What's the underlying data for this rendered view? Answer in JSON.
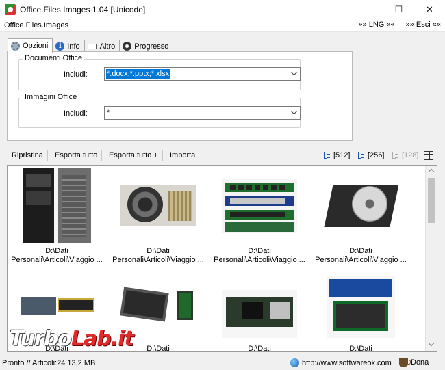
{
  "window": {
    "title": "Office.Files.Images 1.04 [Unicode]",
    "minimize": "–",
    "maximize": "☐",
    "close": "✕"
  },
  "menubar": {
    "app_name": "Office.Files.Images",
    "lng": "»» LNG ««",
    "exit": "»» Esci ««"
  },
  "tabs": [
    {
      "label": "Opzioni",
      "icon": "gear-icon",
      "active": true
    },
    {
      "label": "Info",
      "icon": "info-icon",
      "active": false
    },
    {
      "label": "Altro",
      "icon": "ruler-icon",
      "active": false
    },
    {
      "label": "Progresso",
      "icon": "progress-icon",
      "active": false
    }
  ],
  "options": {
    "office_docs": {
      "title": "Documenti Office",
      "include_label": "Includi:",
      "include_value": "*.docx;*.pptx;*.xlsx"
    },
    "office_images": {
      "title": "Immagini Office",
      "include_label": "Includi:",
      "include_value": "*"
    }
  },
  "toolbar": {
    "reset": "Ripristina",
    "export_all": "Esporta tutto",
    "export_all_plus": "Esporta tutto +",
    "import": "Importa",
    "size_512": "[512]",
    "size_256": "[256]",
    "size_128": "[128]"
  },
  "gallery": {
    "items": [
      {
        "line1": "D:\\Dati",
        "line2": "Personali\\Articoli\\Viaggio ..."
      },
      {
        "line1": "D:\\Dati",
        "line2": "Personali\\Articoli\\Viaggio ..."
      },
      {
        "line1": "D:\\Dati",
        "line2": "Personali\\Articoli\\Viaggio ..."
      },
      {
        "line1": "D:\\Dati",
        "line2": "Personali\\Articoli\\Viaggio ..."
      },
      {
        "line1": "D:\\Dati",
        "line2": ""
      },
      {
        "line1": "D:\\Dati",
        "line2": ""
      },
      {
        "line1": "D:\\Dati",
        "line2": ""
      },
      {
        "line1": "D:\\Dati",
        "line2": ""
      }
    ]
  },
  "watermark": {
    "part1": "Turbo",
    "part2": "Lab.it"
  },
  "status": {
    "text": "Pronto // Articoli:24 13,2 MB",
    "website": "http://www.softwareok.com",
    "donate": "Dona"
  }
}
